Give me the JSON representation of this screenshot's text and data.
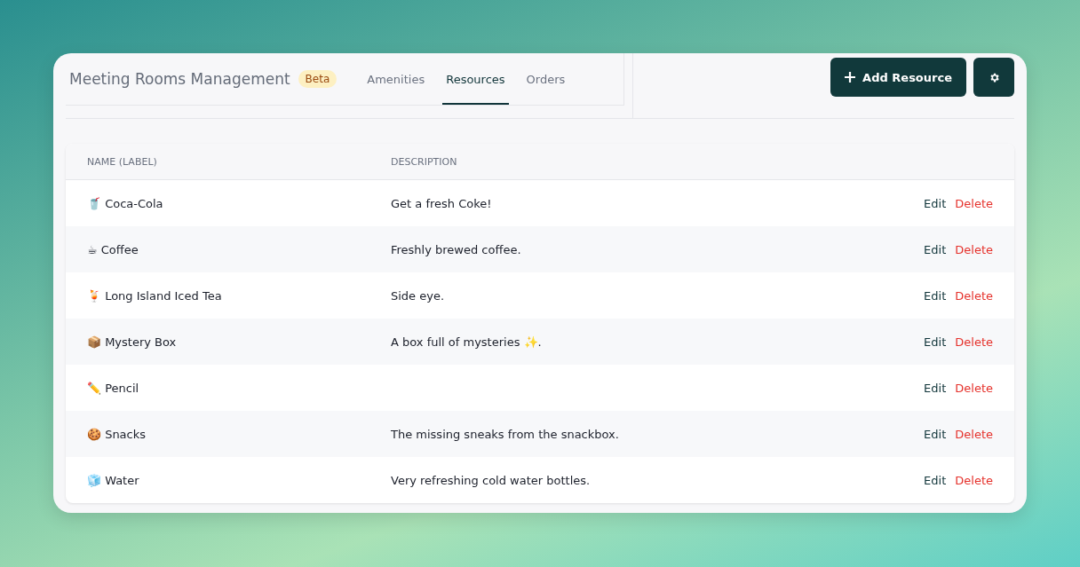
{
  "header": {
    "title": "Meeting Rooms Management",
    "badge": "Beta"
  },
  "tabs": [
    {
      "label": "Amenities",
      "selected": false
    },
    {
      "label": "Resources",
      "selected": true
    },
    {
      "label": "Orders",
      "selected": false
    }
  ],
  "actions": {
    "add_button": "Add Resource"
  },
  "table": {
    "columns": [
      "NAME (LABEL)",
      "DESCRIPTION"
    ],
    "rows": [
      {
        "name": "🥤 Coca-Cola",
        "description": "Get a fresh Coke!",
        "edit": "Edit",
        "delete": "Delete"
      },
      {
        "name": "☕ Coffee",
        "description": "Freshly brewed coffee.",
        "edit": "Edit",
        "delete": "Delete"
      },
      {
        "name": "🍹 Long Island Iced Tea",
        "description": "Side eye.",
        "edit": "Edit",
        "delete": "Delete"
      },
      {
        "name": "📦 Mystery Box",
        "description": "A box full of mysteries ✨.",
        "edit": "Edit",
        "delete": "Delete"
      },
      {
        "name": "✏️ Pencil",
        "description": "",
        "edit": "Edit",
        "delete": "Delete"
      },
      {
        "name": "🍪 Snacks",
        "description": "The missing sneaks from the snackbox.",
        "edit": "Edit",
        "delete": "Delete"
      },
      {
        "name": "🧊 Water",
        "description": "Very refreshing cold water bottles.",
        "edit": "Edit",
        "delete": "Delete"
      }
    ]
  }
}
